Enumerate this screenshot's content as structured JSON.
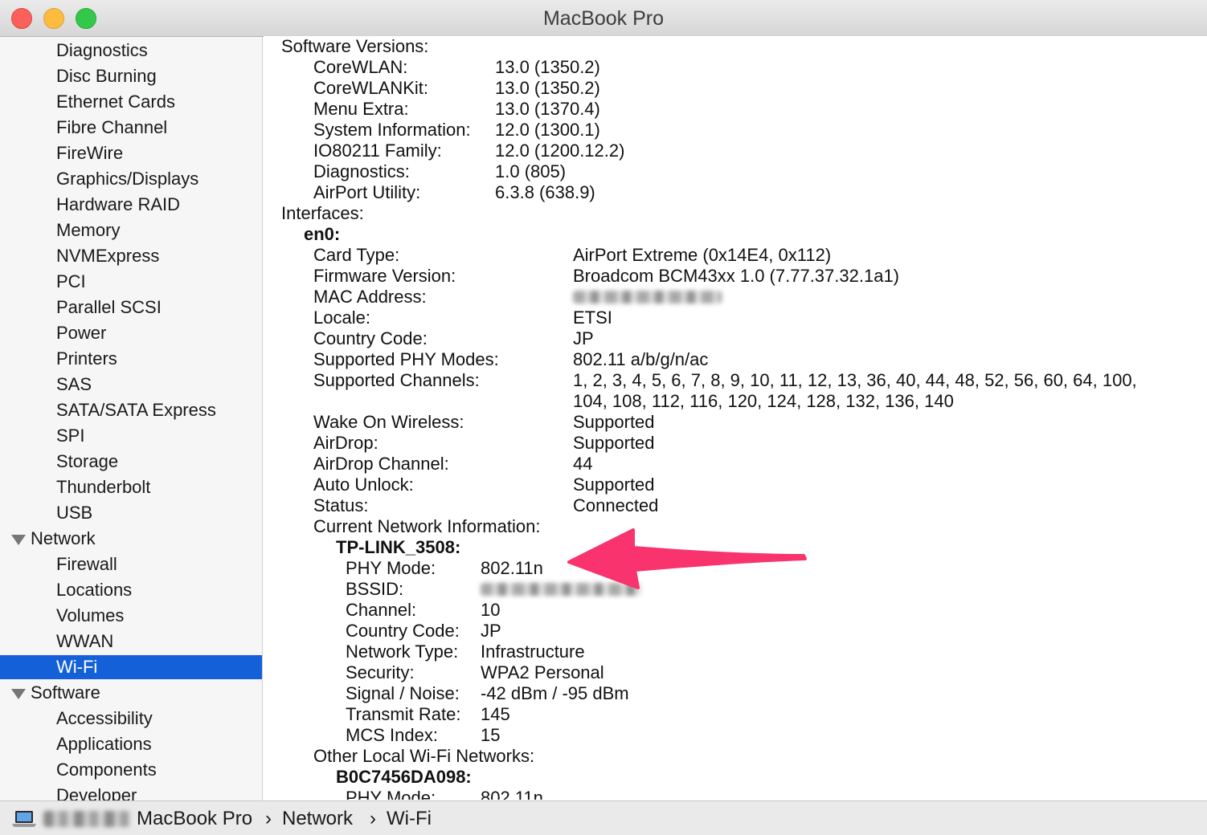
{
  "window": {
    "title": "MacBook Pro"
  },
  "sidebar": {
    "items": [
      {
        "label": "Diagnostics",
        "type": "item"
      },
      {
        "label": "Disc Burning",
        "type": "item"
      },
      {
        "label": "Ethernet Cards",
        "type": "item"
      },
      {
        "label": "Fibre Channel",
        "type": "item"
      },
      {
        "label": "FireWire",
        "type": "item"
      },
      {
        "label": "Graphics/Displays",
        "type": "item"
      },
      {
        "label": "Hardware RAID",
        "type": "item"
      },
      {
        "label": "Memory",
        "type": "item"
      },
      {
        "label": "NVMExpress",
        "type": "item"
      },
      {
        "label": "PCI",
        "type": "item"
      },
      {
        "label": "Parallel SCSI",
        "type": "item"
      },
      {
        "label": "Power",
        "type": "item"
      },
      {
        "label": "Printers",
        "type": "item"
      },
      {
        "label": "SAS",
        "type": "item"
      },
      {
        "label": "SATA/SATA Express",
        "type": "item"
      },
      {
        "label": "SPI",
        "type": "item"
      },
      {
        "label": "Storage",
        "type": "item"
      },
      {
        "label": "Thunderbolt",
        "type": "item"
      },
      {
        "label": "USB",
        "type": "item"
      },
      {
        "label": "Network",
        "type": "group"
      },
      {
        "label": "Firewall",
        "type": "item"
      },
      {
        "label": "Locations",
        "type": "item"
      },
      {
        "label": "Volumes",
        "type": "item"
      },
      {
        "label": "WWAN",
        "type": "item"
      },
      {
        "label": "Wi-Fi",
        "type": "item",
        "selected": true
      },
      {
        "label": "Software",
        "type": "group"
      },
      {
        "label": "Accessibility",
        "type": "item"
      },
      {
        "label": "Applications",
        "type": "item"
      },
      {
        "label": "Components",
        "type": "item"
      },
      {
        "label": "Developer",
        "type": "item"
      }
    ]
  },
  "content": {
    "rows": [
      {
        "key": "Software Versions:",
        "value": "",
        "indent": 0
      },
      {
        "key": "CoreWLAN:",
        "value": "13.0 (1350.2)",
        "indent": 1,
        "col": "a"
      },
      {
        "key": "CoreWLANKit:",
        "value": "13.0 (1350.2)",
        "indent": 1,
        "col": "a"
      },
      {
        "key": "Menu Extra:",
        "value": "13.0 (1370.4)",
        "indent": 1,
        "col": "a"
      },
      {
        "key": "System Information:",
        "value": "12.0 (1300.1)",
        "indent": 1,
        "col": "a"
      },
      {
        "key": "IO80211 Family:",
        "value": "12.0 (1200.12.2)",
        "indent": 1,
        "col": "a"
      },
      {
        "key": "Diagnostics:",
        "value": "1.0 (805)",
        "indent": 1,
        "col": "a"
      },
      {
        "key": "AirPort Utility:",
        "value": "6.3.8 (638.9)",
        "indent": 1,
        "col": "a"
      },
      {
        "key": "Interfaces:",
        "value": "",
        "indent": 0
      },
      {
        "key": "en0:",
        "value": "",
        "indent": "h1",
        "bold": true
      },
      {
        "key": "Card Type:",
        "value": "AirPort Extreme  (0x14E4, 0x112)",
        "indent": 1,
        "col": "b"
      },
      {
        "key": "Firmware Version:",
        "value": "Broadcom BCM43xx 1.0 (7.77.37.32.1a1)",
        "indent": 1,
        "col": "b"
      },
      {
        "key": "MAC Address:",
        "value": "",
        "indent": 1,
        "col": "b",
        "redacted": true
      },
      {
        "key": "Locale:",
        "value": "ETSI",
        "indent": 1,
        "col": "b"
      },
      {
        "key": "Country Code:",
        "value": "JP",
        "indent": 1,
        "col": "b"
      },
      {
        "key": "Supported PHY Modes:",
        "value": "802.11 a/b/g/n/ac",
        "indent": 1,
        "col": "b"
      },
      {
        "key": "Supported Channels:",
        "value": "1, 2, 3, 4, 5, 6, 7, 8, 9, 10, 11, 12, 13, 36, 40, 44, 48, 52, 56, 60, 64, 100,",
        "indent": 1,
        "col": "b"
      },
      {
        "key": "",
        "value": "104, 108, 112, 116, 120, 124, 128, 132, 136, 140",
        "indent": 1,
        "col": "b"
      },
      {
        "key": "Wake On Wireless:",
        "value": "Supported",
        "indent": 1,
        "col": "b"
      },
      {
        "key": "AirDrop:",
        "value": "Supported",
        "indent": 1,
        "col": "b"
      },
      {
        "key": "AirDrop Channel:",
        "value": "44",
        "indent": 1,
        "col": "b"
      },
      {
        "key": "Auto Unlock:",
        "value": "Supported",
        "indent": 1,
        "col": "b"
      },
      {
        "key": "Status:",
        "value": "Connected",
        "indent": 1,
        "col": "b"
      },
      {
        "key": "Current Network Information:",
        "value": "",
        "indent": 1
      },
      {
        "key": "TP-LINK_3508:",
        "value": "",
        "indent": "h2",
        "bold": true
      },
      {
        "key": "PHY Mode:",
        "value": "802.11n",
        "indent": 2,
        "col": "c"
      },
      {
        "key": "BSSID:",
        "value": "",
        "indent": 2,
        "col": "c",
        "redacted": true
      },
      {
        "key": "Channel:",
        "value": "10",
        "indent": 2,
        "col": "c"
      },
      {
        "key": "Country Code:",
        "value": "JP",
        "indent": 2,
        "col": "c"
      },
      {
        "key": "Network Type:",
        "value": "Infrastructure",
        "indent": 2,
        "col": "c"
      },
      {
        "key": "Security:",
        "value": "WPA2 Personal",
        "indent": 2,
        "col": "c"
      },
      {
        "key": "Signal / Noise:",
        "value": "-42 dBm / -95 dBm",
        "indent": 2,
        "col": "c"
      },
      {
        "key": "Transmit Rate:",
        "value": "145",
        "indent": 2,
        "col": "c"
      },
      {
        "key": "MCS Index:",
        "value": "15",
        "indent": 2,
        "col": "c"
      },
      {
        "key": "Other Local Wi-Fi Networks:",
        "value": "",
        "indent": 1
      },
      {
        "key": "B0C7456DA098:",
        "value": "",
        "indent": "h2",
        "bold": true
      },
      {
        "key": "PHY Mode:",
        "value": "802.11n",
        "indent": 2,
        "col": "c"
      }
    ]
  },
  "annotation": {
    "color": "#f8336d",
    "icon": "arrow-left-icon"
  },
  "pathbar": {
    "icon": "laptop-icon",
    "crumbs": [
      "MacBook Pro",
      "Network",
      "Wi-Fi"
    ],
    "separator": "›"
  },
  "colors": {
    "selection": "#1460d8",
    "sidebar_bg": "#f6f6f6"
  }
}
